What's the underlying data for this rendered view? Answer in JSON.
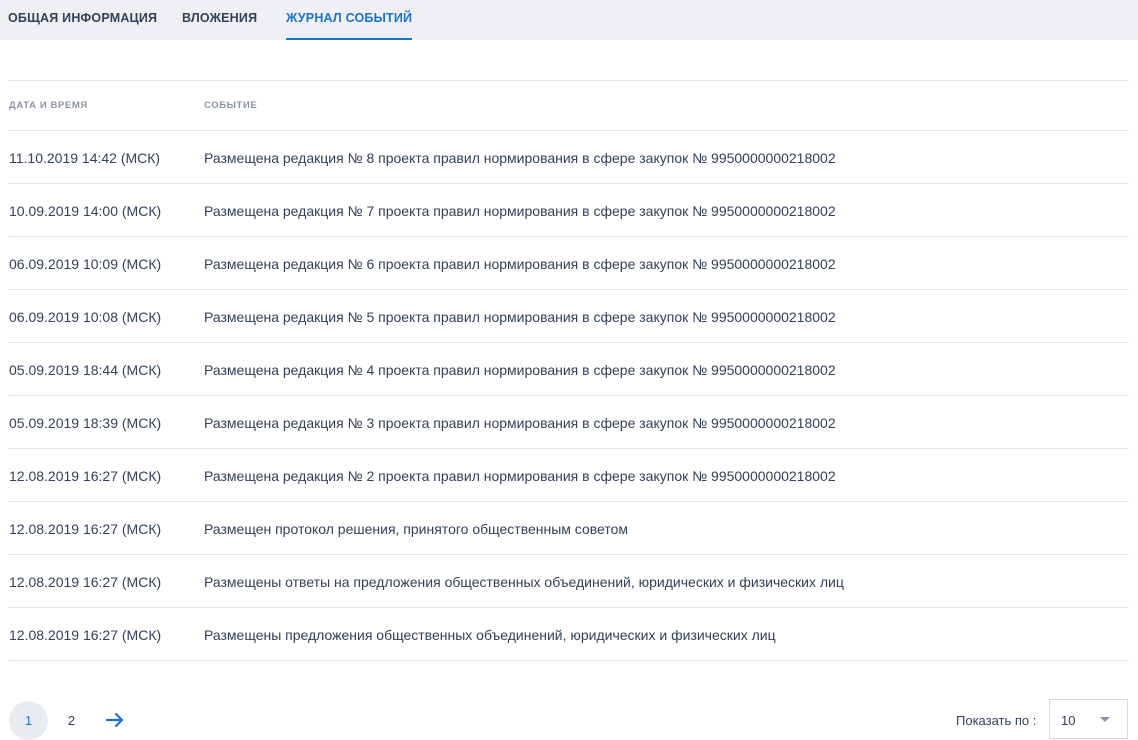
{
  "tabs": [
    {
      "label": "ОБЩАЯ ИНФОРМАЦИЯ",
      "active": false
    },
    {
      "label": "ВЛОЖЕНИЯ",
      "active": false
    },
    {
      "label": "ЖУРНАЛ СОБЫТИЙ",
      "active": true
    }
  ],
  "table": {
    "headers": {
      "date": "ДАТА И ВРЕМЯ",
      "event": "СОБЫТИЕ"
    },
    "rows": [
      {
        "date": "11.10.2019 14:42 (МСК)",
        "event": "Размещена редакция № 8 проекта правил нормирования в сфере закупок № 9950000000218002"
      },
      {
        "date": "10.09.2019 14:00 (МСК)",
        "event": "Размещена редакция № 7 проекта правил нормирования в сфере закупок № 9950000000218002"
      },
      {
        "date": "06.09.2019 10:09 (МСК)",
        "event": "Размещена редакция № 6 проекта правил нормирования в сфере закупок № 9950000000218002"
      },
      {
        "date": "06.09.2019 10:08 (МСК)",
        "event": "Размещена редакция № 5 проекта правил нормирования в сфере закупок № 9950000000218002"
      },
      {
        "date": "05.09.2019 18:44 (МСК)",
        "event": "Размещена редакция № 4 проекта правил нормирования в сфере закупок № 9950000000218002"
      },
      {
        "date": "05.09.2019 18:39 (МСК)",
        "event": "Размещена редакция № 3 проекта правил нормирования в сфере закупок № 9950000000218002"
      },
      {
        "date": "12.08.2019 16:27 (МСК)",
        "event": "Размещена редакция № 2 проекта правил нормирования в сфере закупок № 9950000000218002"
      },
      {
        "date": "12.08.2019 16:27 (МСК)",
        "event": "Размещен протокол решения, принятого общественным советом"
      },
      {
        "date": "12.08.2019 16:27 (МСК)",
        "event": "Размещены ответы на предложения общественных объединений, юридических и физических лиц"
      },
      {
        "date": "12.08.2019 16:27 (МСК)",
        "event": "Размещены предложения общественных объединений, юридических и физических лиц"
      }
    ]
  },
  "pagination": {
    "pages": [
      "1",
      "2"
    ],
    "current": "1",
    "next_icon": "arrow-right-icon",
    "per_page_label": "Показать по :",
    "per_page_value": "10",
    "dropdown_icon": "chevron-down-icon"
  },
  "colors": {
    "accent": "#1a73d1",
    "tabbar_bg": "#eef0f3",
    "text": "#334059",
    "muted": "#8a93a3",
    "divider": "#e2e5ea"
  }
}
